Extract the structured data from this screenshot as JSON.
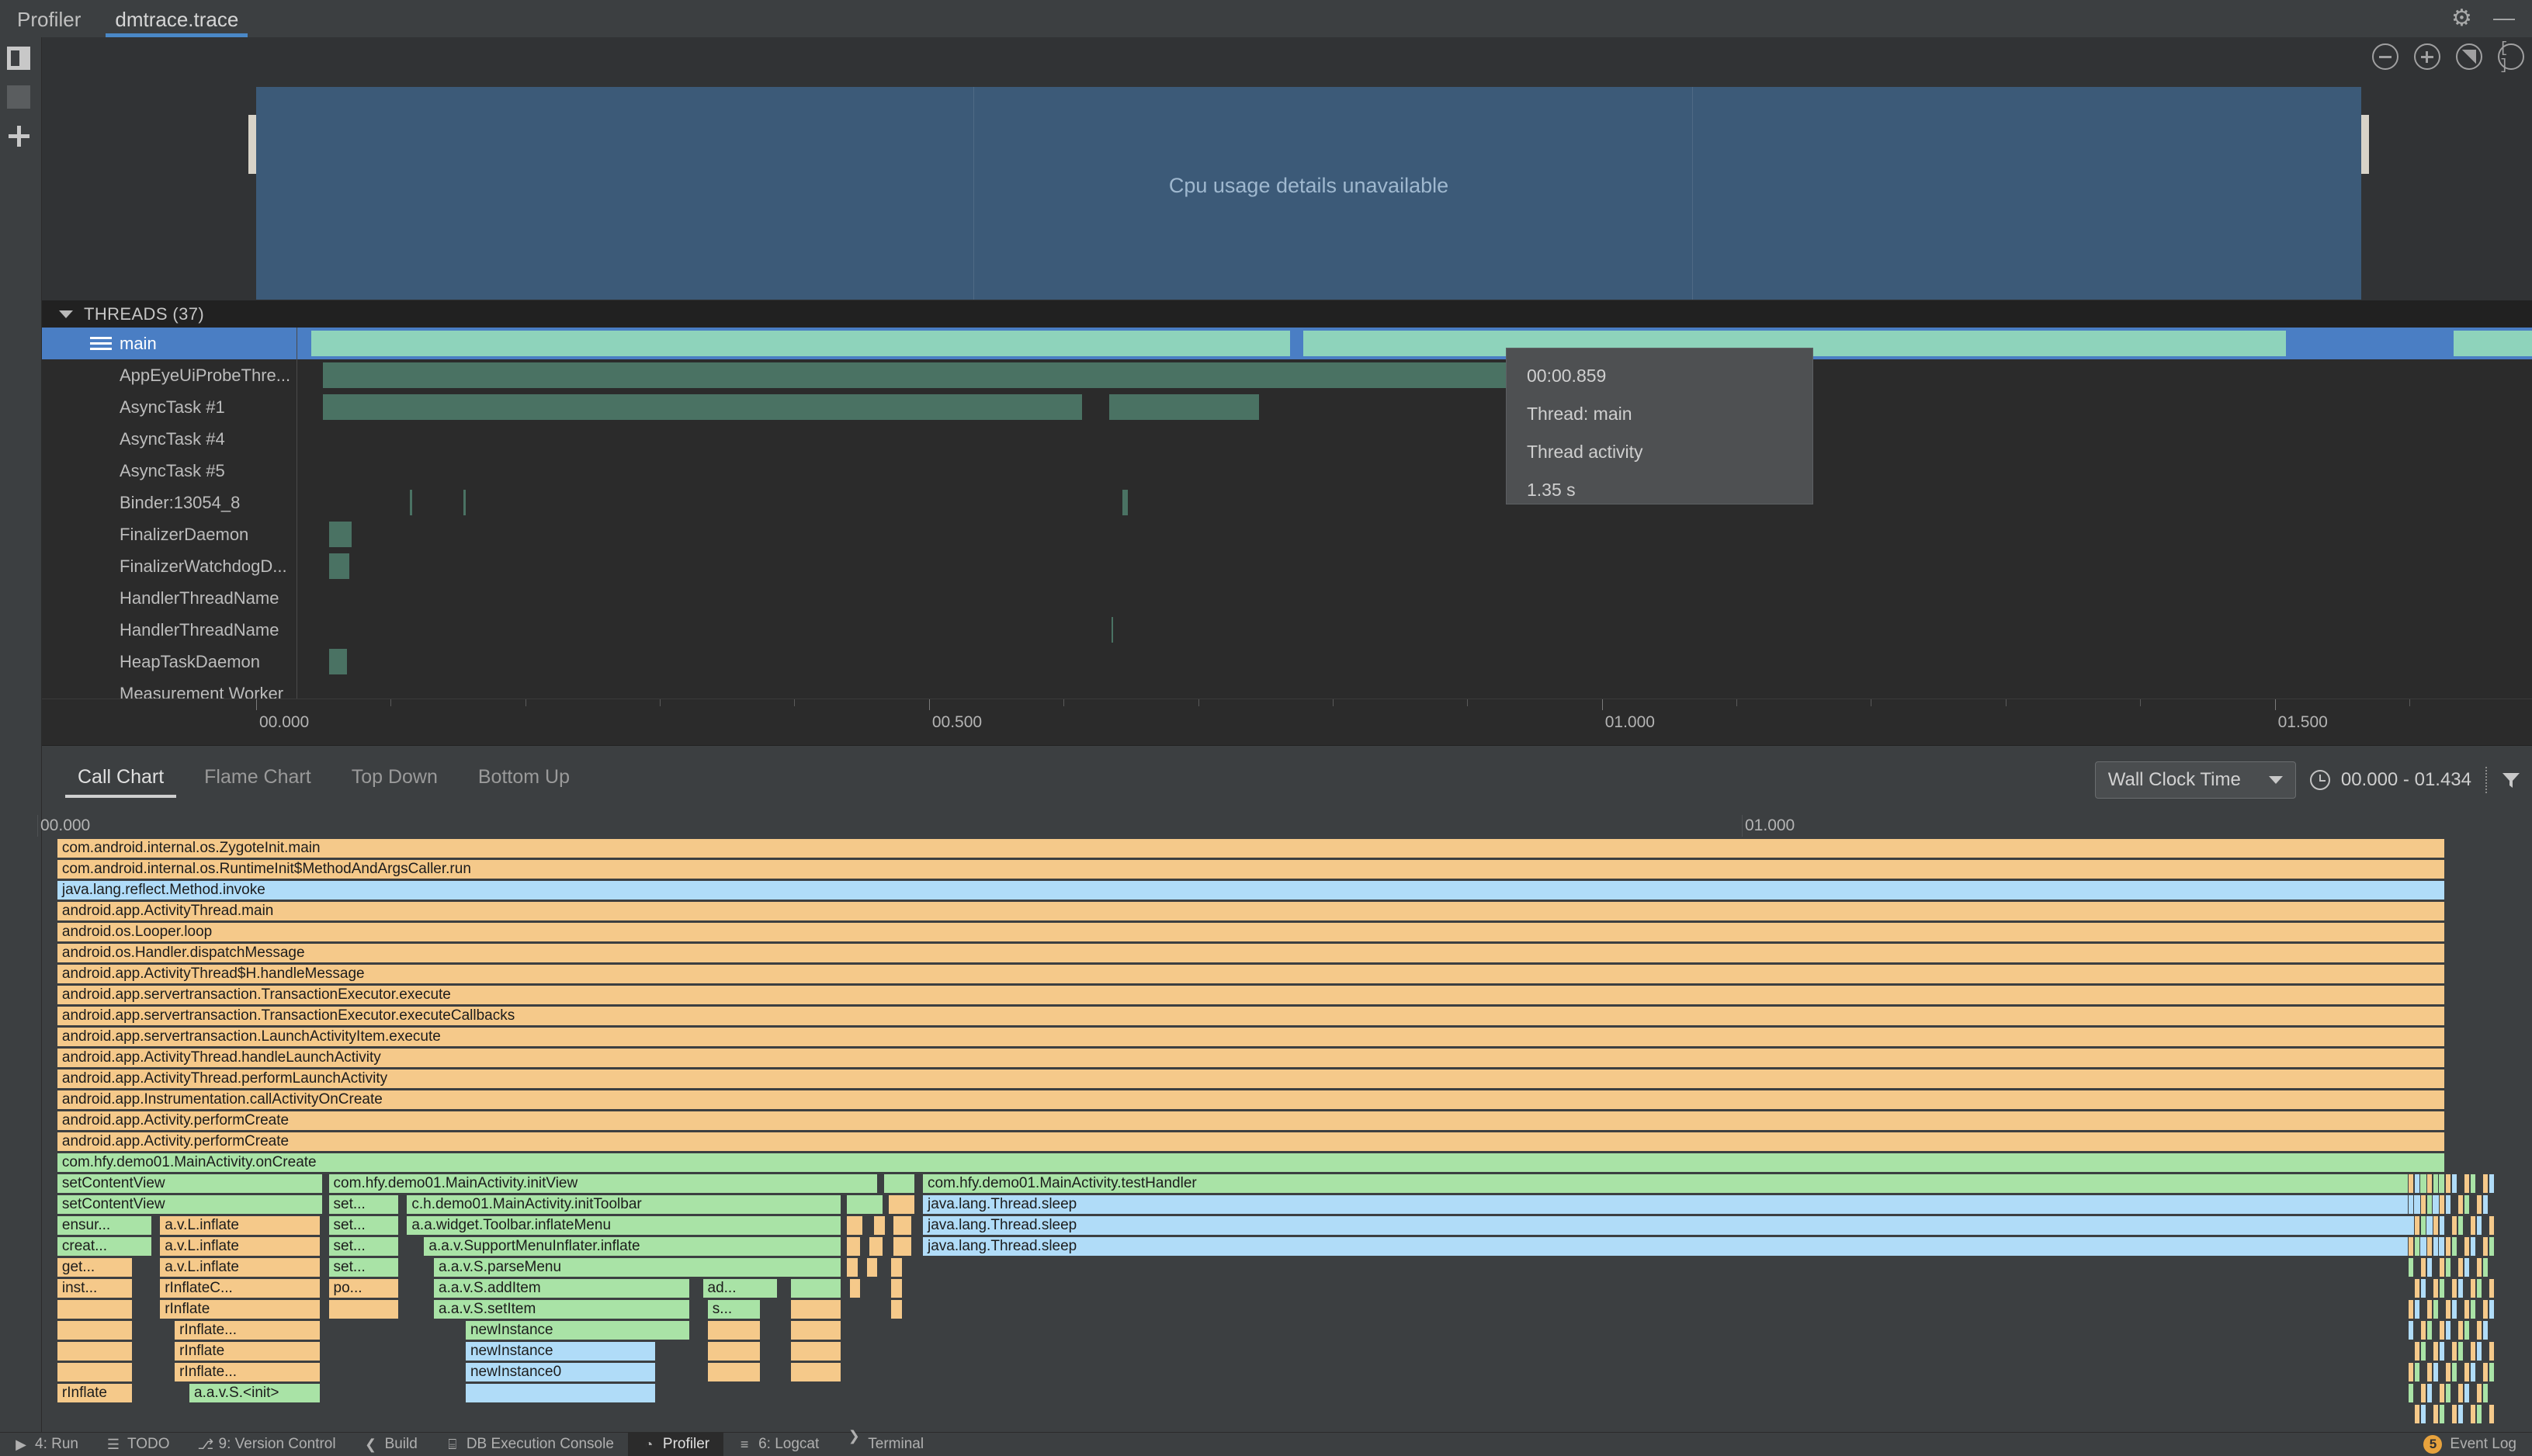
{
  "window": {
    "tabs": [
      {
        "label": "Profiler",
        "active": false
      },
      {
        "label": "dmtrace.trace",
        "active": true
      }
    ],
    "gear_icon": "gear-icon",
    "minimize_icon": "minimize-icon"
  },
  "rail": {
    "buttons": [
      "split-panel-icon",
      "panel-icon",
      "add-icon"
    ]
  },
  "cpu": {
    "message": "Cpu usage details unavailable",
    "toolbar": [
      {
        "name": "zoom-out-button",
        "icon": "minus-circle-icon"
      },
      {
        "name": "zoom-in-button",
        "icon": "plus-circle-icon"
      },
      {
        "name": "reset-zoom-button",
        "icon": "reset-zoom-icon"
      },
      {
        "name": "zoom-to-selection-button",
        "icon": "brackets-circle-icon"
      }
    ]
  },
  "threads": {
    "header": "THREADS (37)",
    "items": [
      {
        "name": "main",
        "selected": true,
        "segments": [
          {
            "start": 0.6,
            "width": 43.8,
            "color": "mint"
          },
          {
            "start": 45.0,
            "width": 44.0,
            "color": "mint"
          },
          {
            "start": 96.5,
            "width": 3.5,
            "color": "mint"
          }
        ]
      },
      {
        "name": "AppEyeUiProbeThre...",
        "selected": false,
        "segments": [
          {
            "start": 1.1,
            "width": 53.0,
            "color": "dgreen"
          }
        ]
      },
      {
        "name": "AsyncTask #1",
        "selected": false,
        "segments": [
          {
            "start": 1.1,
            "width": 34.0,
            "color": "dgreen"
          },
          {
            "start": 36.3,
            "width": 6.7,
            "color": "dgreen"
          }
        ]
      },
      {
        "name": "AsyncTask #4",
        "selected": false,
        "segments": []
      },
      {
        "name": "AsyncTask #5",
        "selected": false,
        "segments": []
      },
      {
        "name": "Binder:13054_8",
        "selected": false,
        "segments": [
          {
            "start": 5.0,
            "width": 0.1,
            "color": "dgreen"
          },
          {
            "start": 7.4,
            "width": 0.1,
            "color": "dgreen"
          },
          {
            "start": 36.9,
            "width": 0.25,
            "color": "dgreen"
          }
        ]
      },
      {
        "name": "FinalizerDaemon",
        "selected": false,
        "segments": [
          {
            "start": 1.4,
            "width": 1.0,
            "color": "dgreen"
          }
        ]
      },
      {
        "name": "FinalizerWatchdogD...",
        "selected": false,
        "segments": [
          {
            "start": 1.4,
            "width": 0.9,
            "color": "dgreen"
          }
        ]
      },
      {
        "name": "HandlerThreadName",
        "selected": false,
        "segments": []
      },
      {
        "name": "HandlerThreadName",
        "selected": false,
        "segments": [
          {
            "start": 36.4,
            "width": 0.06,
            "color": "dgreen"
          }
        ]
      },
      {
        "name": "HeapTaskDaemon",
        "selected": false,
        "segments": [
          {
            "start": 1.4,
            "width": 0.8,
            "color": "dgreen"
          }
        ]
      },
      {
        "name": "Measurement Worker",
        "selected": false,
        "segments": []
      }
    ]
  },
  "ruler": {
    "labels": [
      "00.000",
      "00.500",
      "01.000",
      "01.500"
    ]
  },
  "tooltip": {
    "time": "00:00.859",
    "thread": "Thread: main",
    "activity": "Thread activity",
    "duration": "1.35 s"
  },
  "call_chart": {
    "tabs": [
      {
        "label": "Call Chart",
        "active": true
      },
      {
        "label": "Flame Chart",
        "active": false
      },
      {
        "label": "Top Down",
        "active": false
      },
      {
        "label": "Bottom Up",
        "active": false
      }
    ],
    "clock_select": "Wall Clock Time",
    "range": "00.000 - 01.434",
    "filter_icon": "filter-icon",
    "axis_labels": [
      "00.000",
      "01.000"
    ],
    "rows": [
      [
        {
          "label": "com.android.internal.os.ZygoteInit.main",
          "start": 0.6,
          "width": 97.7,
          "color": "f-orange"
        }
      ],
      [
        {
          "label": "com.android.internal.os.RuntimeInit$MethodAndArgsCaller.run",
          "start": 0.6,
          "width": 97.7,
          "color": "f-orange"
        }
      ],
      [
        {
          "label": "java.lang.reflect.Method.invoke",
          "start": 0.6,
          "width": 97.7,
          "color": "f-blue"
        }
      ],
      [
        {
          "label": "android.app.ActivityThread.main",
          "start": 0.6,
          "width": 97.7,
          "color": "f-orange"
        }
      ],
      [
        {
          "label": "android.os.Looper.loop",
          "start": 0.6,
          "width": 97.7,
          "color": "f-orange"
        }
      ],
      [
        {
          "label": "android.os.Handler.dispatchMessage",
          "start": 0.6,
          "width": 97.7,
          "color": "f-orange"
        }
      ],
      [
        {
          "label": "android.app.ActivityThread$H.handleMessage",
          "start": 0.6,
          "width": 97.7,
          "color": "f-orange"
        }
      ],
      [
        {
          "label": "android.app.servertransaction.TransactionExecutor.execute",
          "start": 0.6,
          "width": 97.7,
          "color": "f-orange"
        }
      ],
      [
        {
          "label": "android.app.servertransaction.TransactionExecutor.executeCallbacks",
          "start": 0.6,
          "width": 97.7,
          "color": "f-orange"
        }
      ],
      [
        {
          "label": "android.app.servertransaction.LaunchActivityItem.execute",
          "start": 0.6,
          "width": 97.7,
          "color": "f-orange"
        }
      ],
      [
        {
          "label": "android.app.ActivityThread.handleLaunchActivity",
          "start": 0.6,
          "width": 97.7,
          "color": "f-orange"
        }
      ],
      [
        {
          "label": "android.app.ActivityThread.performLaunchActivity",
          "start": 0.6,
          "width": 97.7,
          "color": "f-orange"
        }
      ],
      [
        {
          "label": "android.app.Instrumentation.callActivityOnCreate",
          "start": 0.6,
          "width": 97.7,
          "color": "f-orange"
        }
      ],
      [
        {
          "label": "android.app.Activity.performCreate",
          "start": 0.6,
          "width": 97.7,
          "color": "f-orange"
        }
      ],
      [
        {
          "label": "android.app.Activity.performCreate",
          "start": 0.6,
          "width": 97.7,
          "color": "f-orange"
        }
      ],
      [
        {
          "label": "com.hfy.demo01.MainActivity.onCreate",
          "start": 0.6,
          "width": 97.7,
          "color": "f-green"
        }
      ],
      [
        {
          "label": "setContentView",
          "start": 0.6,
          "width": 10.9,
          "color": "f-green"
        },
        {
          "label": "com.hfy.demo01.MainActivity.initView",
          "start": 11.7,
          "width": 22.5,
          "color": "f-green"
        },
        {
          "label": "",
          "start": 34.4,
          "width": 1.3,
          "color": "f-green"
        },
        {
          "label": "com.hfy.demo01.MainActivity.testHandler",
          "start": 36.0,
          "width": 62.3,
          "color": "f-green"
        }
      ],
      [
        {
          "label": "setContentView",
          "start": 0.6,
          "width": 10.9,
          "color": "f-green"
        },
        {
          "label": "set...",
          "start": 11.7,
          "width": 2.9,
          "color": "f-green"
        },
        {
          "label": "c.h.demo01.MainActivity.initToolbar",
          "start": 14.9,
          "width": 17.8,
          "color": "f-green"
        },
        {
          "label": "",
          "start": 32.9,
          "width": 1.5,
          "color": "f-green"
        },
        {
          "label": "",
          "start": 34.6,
          "width": 1.1,
          "color": "f-orange"
        },
        {
          "label": "java.lang.Thread.sleep",
          "start": 36.0,
          "width": 62.3,
          "color": "f-blue"
        }
      ],
      [
        {
          "label": "ensur...",
          "start": 0.6,
          "width": 3.9,
          "color": "f-green"
        },
        {
          "label": "a.v.L.inflate",
          "start": 4.8,
          "width": 6.6,
          "color": "f-orange"
        },
        {
          "label": "set...",
          "start": 11.7,
          "width": 2.9,
          "color": "f-green"
        },
        {
          "label": "a.a.widget.Toolbar.inflateMenu",
          "start": 14.9,
          "width": 17.8,
          "color": "f-green"
        },
        {
          "label": "",
          "start": 32.9,
          "width": 0.7,
          "color": "f-orange"
        },
        {
          "label": "",
          "start": 34.0,
          "width": 0.5,
          "color": "f-orange"
        },
        {
          "label": "",
          "start": 34.8,
          "width": 0.8,
          "color": "f-orange"
        },
        {
          "label": "java.lang.Thread.sleep",
          "start": 36.0,
          "width": 62.3,
          "color": "f-blue"
        }
      ],
      [
        {
          "label": "creat...",
          "start": 0.6,
          "width": 3.9,
          "color": "f-green"
        },
        {
          "label": "a.v.L.inflate",
          "start": 4.8,
          "width": 6.6,
          "color": "f-orange"
        },
        {
          "label": "set...",
          "start": 11.7,
          "width": 2.9,
          "color": "f-green"
        },
        {
          "label": "a.a.v.SupportMenuInflater.inflate",
          "start": 15.6,
          "width": 17.1,
          "color": "f-green"
        },
        {
          "label": "",
          "start": 32.9,
          "width": 0.6,
          "color": "f-orange"
        },
        {
          "label": "",
          "start": 33.8,
          "width": 0.6,
          "color": "f-orange"
        },
        {
          "label": "",
          "start": 34.8,
          "width": 0.8,
          "color": "f-orange"
        },
        {
          "label": "java.lang.Thread.sleep",
          "start": 36.0,
          "width": 62.3,
          "color": "f-blue"
        }
      ],
      [
        {
          "label": "get...",
          "start": 0.6,
          "width": 3.1,
          "color": "f-orange"
        },
        {
          "label": "a.v.L.inflate",
          "start": 4.8,
          "width": 6.6,
          "color": "f-orange"
        },
        {
          "label": "set...",
          "start": 11.7,
          "width": 2.9,
          "color": "f-green"
        },
        {
          "label": "a.a.v.S.parseMenu",
          "start": 16.0,
          "width": 16.7,
          "color": "f-green"
        },
        {
          "label": "",
          "start": 32.9,
          "width": 0.5,
          "color": "f-orange"
        },
        {
          "label": "",
          "start": 33.7,
          "width": 0.5,
          "color": "f-orange"
        },
        {
          "label": "",
          "start": 34.7,
          "width": 0.5,
          "color": "f-orange"
        }
      ],
      [
        {
          "label": "inst...",
          "start": 0.6,
          "width": 3.1,
          "color": "f-orange"
        },
        {
          "label": "rInflateC...",
          "start": 4.8,
          "width": 6.6,
          "color": "f-orange"
        },
        {
          "label": "po...",
          "start": 11.7,
          "width": 2.9,
          "color": "f-orange"
        },
        {
          "label": "a.a.v.S.addItem",
          "start": 16.0,
          "width": 10.5,
          "color": "f-green"
        },
        {
          "label": "ad...",
          "start": 27.0,
          "width": 3.1,
          "color": "f-green"
        },
        {
          "label": "",
          "start": 30.6,
          "width": 2.1,
          "color": "f-green"
        },
        {
          "label": "",
          "start": 33.0,
          "width": 0.5,
          "color": "f-orange"
        },
        {
          "label": "",
          "start": 34.7,
          "width": 0.5,
          "color": "f-orange"
        }
      ],
      [
        {
          "label": "",
          "start": 0.6,
          "width": 3.1,
          "color": "f-orange"
        },
        {
          "label": "rInflate",
          "start": 4.8,
          "width": 6.6,
          "color": "f-orange"
        },
        {
          "label": "",
          "start": 11.7,
          "width": 2.9,
          "color": "f-orange"
        },
        {
          "label": "a.a.v.S.setItem",
          "start": 16.0,
          "width": 10.5,
          "color": "f-green"
        },
        {
          "label": "s...",
          "start": 27.2,
          "width": 2.2,
          "color": "f-green"
        },
        {
          "label": "",
          "start": 30.6,
          "width": 2.1,
          "color": "f-orange"
        },
        {
          "label": "",
          "start": 34.7,
          "width": 0.5,
          "color": "f-orange"
        }
      ],
      [
        {
          "label": "",
          "start": 0.6,
          "width": 3.1,
          "color": "f-orange"
        },
        {
          "label": "rInflate...",
          "start": 5.4,
          "width": 6.0,
          "color": "f-orange"
        },
        {
          "label": "newInstance",
          "start": 17.3,
          "width": 9.2,
          "color": "f-green"
        },
        {
          "label": "",
          "start": 27.2,
          "width": 2.2,
          "color": "f-orange"
        },
        {
          "label": "",
          "start": 30.6,
          "width": 2.1,
          "color": "f-orange"
        }
      ],
      [
        {
          "label": "",
          "start": 0.6,
          "width": 3.1,
          "color": "f-orange"
        },
        {
          "label": "rInflate",
          "start": 5.4,
          "width": 6.0,
          "color": "f-orange"
        },
        {
          "label": "newInstance",
          "start": 17.3,
          "width": 7.8,
          "color": "f-blue"
        },
        {
          "label": "",
          "start": 27.2,
          "width": 2.2,
          "color": "f-orange"
        },
        {
          "label": "",
          "start": 30.6,
          "width": 2.1,
          "color": "f-orange"
        }
      ],
      [
        {
          "label": "",
          "start": 0.6,
          "width": 3.1,
          "color": "f-orange"
        },
        {
          "label": "rInflate...",
          "start": 5.4,
          "width": 6.0,
          "color": "f-orange"
        },
        {
          "label": "newInstance0",
          "start": 17.3,
          "width": 7.8,
          "color": "f-blue"
        },
        {
          "label": "",
          "start": 27.2,
          "width": 2.2,
          "color": "f-orange"
        },
        {
          "label": "",
          "start": 30.6,
          "width": 2.1,
          "color": "f-orange"
        }
      ],
      [
        {
          "label": "rInflate",
          "start": 0.6,
          "width": 3.1,
          "color": "f-orange"
        },
        {
          "label": "a.a.v.S.<init>",
          "start": 6.0,
          "width": 5.4,
          "color": "f-green"
        },
        {
          "label": "",
          "start": 17.3,
          "width": 7.8,
          "color": "f-blue"
        }
      ]
    ]
  },
  "statusbar": {
    "items": [
      {
        "label": "4: Run",
        "icon": "run-icon",
        "active": false
      },
      {
        "label": "TODO",
        "icon": "todo-icon",
        "active": false
      },
      {
        "label": "9: Version Control",
        "icon": "vcs-icon",
        "active": false
      },
      {
        "label": "Build",
        "icon": "build-icon",
        "active": false
      },
      {
        "label": "DB Execution Console",
        "icon": "database-icon",
        "active": false
      },
      {
        "label": "Profiler",
        "icon": "profiler-icon",
        "active": true
      },
      {
        "label": "6: Logcat",
        "icon": "logcat-icon",
        "active": false
      },
      {
        "label": "Terminal",
        "icon": "terminal-icon",
        "active": false
      }
    ],
    "event_log": {
      "label": "Event Log",
      "count": "5"
    }
  },
  "colors": {
    "accent_blue": "#4a88c7",
    "selection_blue": "#4a7ec4",
    "cpu_panel": "#3c5a78",
    "thread_main": "#8ed3bb",
    "thread_other": "#4a7263",
    "frame_orange": "#f5c98a",
    "frame_green": "#a9e3a6",
    "frame_blue": "#b0dcf8",
    "badge_amber": "#e8a33d"
  }
}
